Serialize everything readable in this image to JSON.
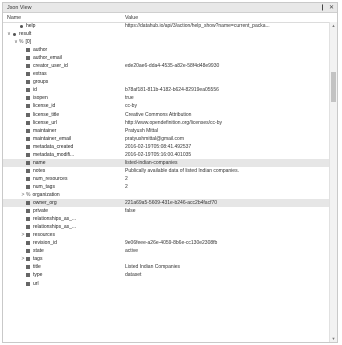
{
  "window": {
    "title": "Json View",
    "pin_glyph": "❙",
    "close_glyph": "✕"
  },
  "columns": {
    "name": "Name",
    "value": "Value"
  },
  "rows": [
    {
      "indent": 1,
      "expander": "",
      "icon": "dot",
      "name": "help",
      "value": "https://datahub.io/api/3/action/help_show?name=current_packa..."
    },
    {
      "indent": 0,
      "expander": "∨",
      "icon": "dot",
      "name": "result",
      "value": ""
    },
    {
      "indent": 1,
      "expander": "∨",
      "icon": "pct",
      "name": "[0]",
      "value": ""
    },
    {
      "indent": 2,
      "expander": "",
      "icon": "sq",
      "name": "author",
      "value": ""
    },
    {
      "indent": 2,
      "expander": "",
      "icon": "sq",
      "name": "author_email",
      "value": ""
    },
    {
      "indent": 2,
      "expander": "",
      "icon": "sq",
      "name": "creator_user_id",
      "value": "ede20ae6-dda4-4535-a82e-58f4d48e9930"
    },
    {
      "indent": 2,
      "expander": "",
      "icon": "sq",
      "name": "extras",
      "value": ""
    },
    {
      "indent": 2,
      "expander": "",
      "icon": "sq",
      "name": "groups",
      "value": ""
    },
    {
      "indent": 2,
      "expander": "",
      "icon": "sq",
      "name": "id",
      "value": "b78af181-811b-4182-b624-82919ea05556"
    },
    {
      "indent": 2,
      "expander": "",
      "icon": "sq",
      "name": "isopen",
      "value": "true"
    },
    {
      "indent": 2,
      "expander": "",
      "icon": "sq",
      "name": "license_id",
      "value": "cc-by"
    },
    {
      "indent": 2,
      "expander": "",
      "icon": "sq",
      "name": "license_title",
      "value": "Creative Commons Attribution"
    },
    {
      "indent": 2,
      "expander": "",
      "icon": "sq",
      "name": "license_url",
      "value": "http://www.opendefinition.org/licenses/cc-by"
    },
    {
      "indent": 2,
      "expander": "",
      "icon": "sq",
      "name": "maintainer",
      "value": "Pratyush Mittal"
    },
    {
      "indent": 2,
      "expander": "",
      "icon": "sq",
      "name": "maintainer_email",
      "value": "pratyushmittal@gmail.com"
    },
    {
      "indent": 2,
      "expander": "",
      "icon": "sq",
      "name": "metadata_created",
      "value": "2016-02-19T05:08:41.492537"
    },
    {
      "indent": 2,
      "expander": "",
      "icon": "sq",
      "name": "metadata_modifi...",
      "value": "2016-02-19T05:16:00.401035"
    },
    {
      "indent": 2,
      "expander": "",
      "icon": "sq",
      "name": "name",
      "value": "listed-indian-companies",
      "selected": true
    },
    {
      "indent": 2,
      "expander": "",
      "icon": "sq",
      "name": "notes",
      "value": "Publically available data of listed Indian companies."
    },
    {
      "indent": 2,
      "expander": "",
      "icon": "sq",
      "name": "num_resources",
      "value": "2"
    },
    {
      "indent": 2,
      "expander": "",
      "icon": "sq",
      "name": "num_tags",
      "value": "2"
    },
    {
      "indent": 2,
      "expander": ">",
      "icon": "pct",
      "name": "organization",
      "value": ""
    },
    {
      "indent": 2,
      "expander": "",
      "icon": "sq",
      "name": "owner_org",
      "value": "221a69a5-5609-431e-b246-acc2b4facf70",
      "selected": true
    },
    {
      "indent": 2,
      "expander": "",
      "icon": "sq",
      "name": "private",
      "value": "false"
    },
    {
      "indent": 2,
      "expander": "",
      "icon": "sq",
      "name": "relationships_as_...",
      "value": ""
    },
    {
      "indent": 2,
      "expander": "",
      "icon": "sq",
      "name": "relationships_as_...",
      "value": ""
    },
    {
      "indent": 2,
      "expander": ">",
      "icon": "sq",
      "name": "resources",
      "value": ""
    },
    {
      "indent": 2,
      "expander": "",
      "icon": "sq",
      "name": "revision_id",
      "value": "9e06feee-a26e-4059-8b6e-cc130e2308fb"
    },
    {
      "indent": 2,
      "expander": "",
      "icon": "sq",
      "name": "state",
      "value": "active"
    },
    {
      "indent": 2,
      "expander": ">",
      "icon": "sq",
      "name": "tags",
      "value": ""
    },
    {
      "indent": 2,
      "expander": "",
      "icon": "sq",
      "name": "title",
      "value": "Listed Indian Companies"
    },
    {
      "indent": 2,
      "expander": "",
      "icon": "sq",
      "name": "type",
      "value": "dataset"
    },
    {
      "indent": 2,
      "expander": "",
      "icon": "sq",
      "name": "url",
      "value": ""
    }
  ],
  "colors": {
    "selected_row": "#e6e6e6",
    "icon": "#666666"
  }
}
